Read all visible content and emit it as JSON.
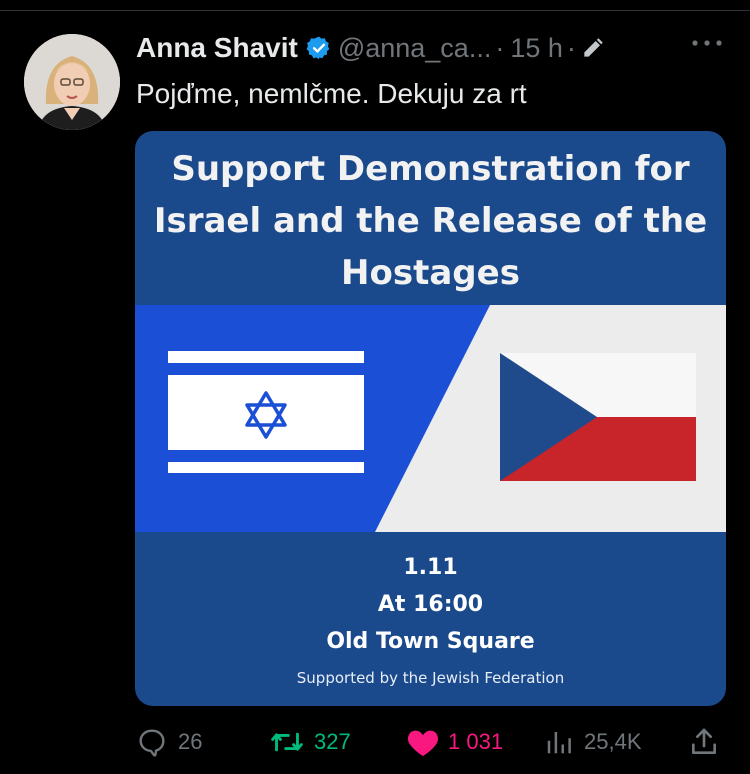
{
  "tweet": {
    "author_name": "Anna Shavit",
    "handle": "@anna_ca...",
    "separator": "·",
    "time": "15 h",
    "time_separator": "·",
    "text": "Pojďme, nemlčme. Dekuju za rt"
  },
  "poster": {
    "title_lines": [
      "Support Demonstration for",
      "Israel and the Release of the",
      "Hostages"
    ],
    "date": "1.11",
    "time": "At 16:00",
    "place": "Old Town Square",
    "supporter": "Supported by the Jewish Federation",
    "colors": {
      "background": "#1a4a8c",
      "israel_blue": "#1b4fd6",
      "czech_blue": "#1f4a8b",
      "czech_red": "#c8252a",
      "white": "#ececec"
    }
  },
  "actions": {
    "replies": "26",
    "reposts": "327",
    "likes": "1 031",
    "views": "25,4K"
  },
  "colors": {
    "background": "#000000",
    "text": "#e7e9ea",
    "muted": "#71767b",
    "verified": "#1d9bf0",
    "repost_active": "#00ba7c",
    "like_active": "#f91880"
  },
  "icons": [
    "verified-badge-icon",
    "edit-pencil-icon",
    "more-options-icon",
    "reply-icon",
    "repost-icon",
    "like-heart-icon",
    "views-chart-icon",
    "share-icon"
  ]
}
